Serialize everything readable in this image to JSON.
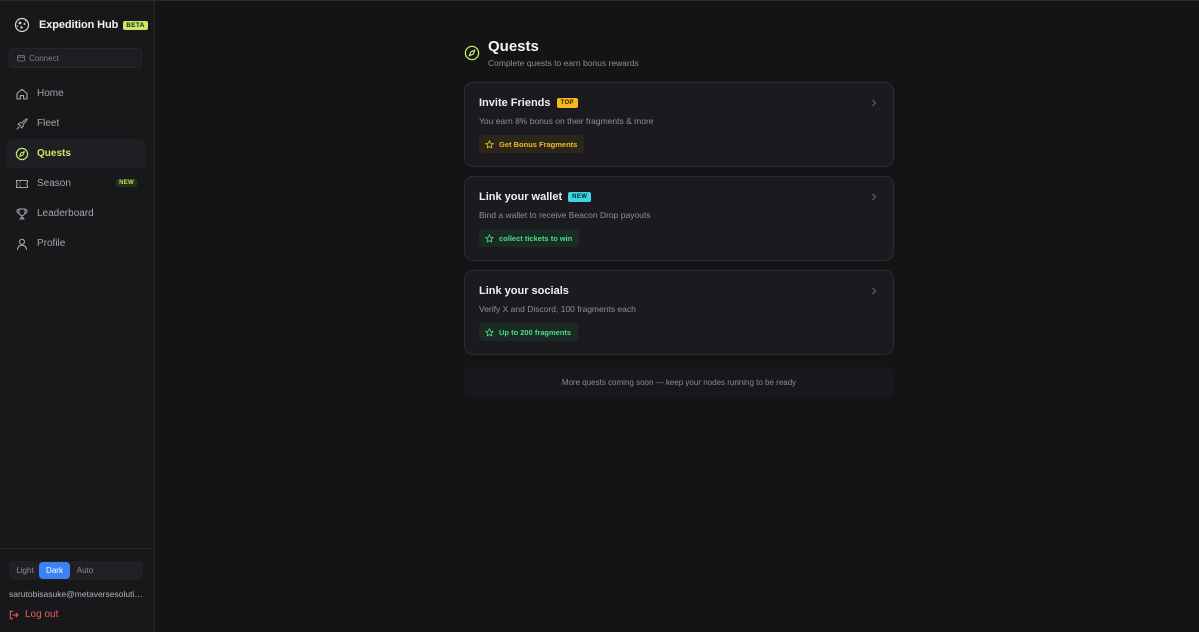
{
  "app": {
    "name": "Expedition Hub",
    "badge": "BETA"
  },
  "connect": {
    "label": "Connect"
  },
  "nav": [
    {
      "label": "Home",
      "icon": "home-icon",
      "active": false
    },
    {
      "label": "Fleet",
      "icon": "rocket-icon",
      "active": false
    },
    {
      "label": "Quests",
      "icon": "compass-icon",
      "active": true
    },
    {
      "label": "Season",
      "icon": "ticket-icon",
      "active": false,
      "badge": "NEW"
    },
    {
      "label": "Leaderboard",
      "icon": "trophy-icon",
      "active": false
    },
    {
      "label": "Profile",
      "icon": "user-icon",
      "active": false
    }
  ],
  "theme": {
    "options": [
      "Light",
      "Dark",
      "Auto"
    ],
    "selected": "Dark"
  },
  "user": {
    "email": "sarutobisasuke@metaversesolutions.com"
  },
  "logout": {
    "label": "Log out"
  },
  "page": {
    "title": "Quests",
    "subtitle": "Complete quests to earn bonus rewards"
  },
  "quests": [
    {
      "title": "Invite Friends",
      "tag": "TOP",
      "description": "You earn 8% bonus on their fragments & more",
      "reward": "Get Bonus Fragments"
    },
    {
      "title": "Link your wallet",
      "tag": "NEW",
      "description": "Bind a wallet to receive Beacon Drop payouts",
      "reward": "collect tickets to win"
    },
    {
      "title": "Link your socials",
      "description": "Verify X and Discord, 100 fragments each",
      "reward": "Up to 200 fragments"
    }
  ],
  "footer_note": "More quests coming soon — keep your nodes running to be ready",
  "colors": {
    "accent": "#c8e86a",
    "theme_active": "#3b82f6",
    "logout": "#f05a5a",
    "top_tag": "#f5b81e",
    "new_tag": "#3fd6e4",
    "reward_green": "#4ade80"
  }
}
